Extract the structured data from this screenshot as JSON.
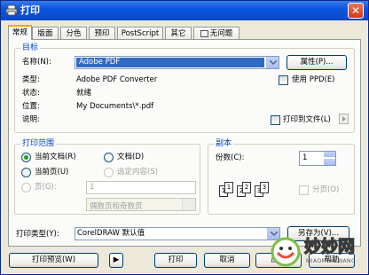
{
  "title": "打印",
  "tabs": [
    "常规",
    "版面",
    "分色",
    "预印",
    "PostScript",
    "其它",
    "无问题"
  ],
  "destination": {
    "group_title": "目标",
    "name_label": "名称(N):",
    "name_value": "Adobe PDF",
    "properties_btn": "属性(P)...",
    "type_label": "类型:",
    "type_value": "Adobe PDF Converter",
    "status_label": "状态:",
    "status_value": "就绪",
    "location_label": "位置:",
    "location_value": "My Documents\\*.pdf",
    "comment_label": "说明:",
    "use_ppd": "使用 PPD(E)",
    "print_to_file": "打印到文件(L)"
  },
  "range": {
    "group_title": "打印范围",
    "current_doc": "当前文档(R)",
    "documents": "文档(D)",
    "current_page": "当前页(U)",
    "selection": "选定内容(S)",
    "pages": "页(G):",
    "pages_value": "1",
    "even_odd": "偶数页和奇数页"
  },
  "copies": {
    "group_title": "副本",
    "count_label": "份数(C):",
    "count_value": "1",
    "collate": "分页(O)",
    "pages_a": [
      "1",
      "2",
      "3"
    ],
    "pages_b": [
      "1",
      "2",
      "3"
    ]
  },
  "print_style": {
    "label": "打印类型(Y):",
    "value": "CorelDRAW 默认值",
    "save_as_btn": "另存为(V)..."
  },
  "footer": {
    "preview_btn": "打印预览(W)",
    "expand_btn": "▶",
    "print_btn": "打印",
    "cancel_btn": "取消",
    "apply_btn": "应用",
    "help_btn": "帮助"
  },
  "watermark": {
    "text": "妙妙网",
    "sub": "MIAOMIAOWANG"
  }
}
